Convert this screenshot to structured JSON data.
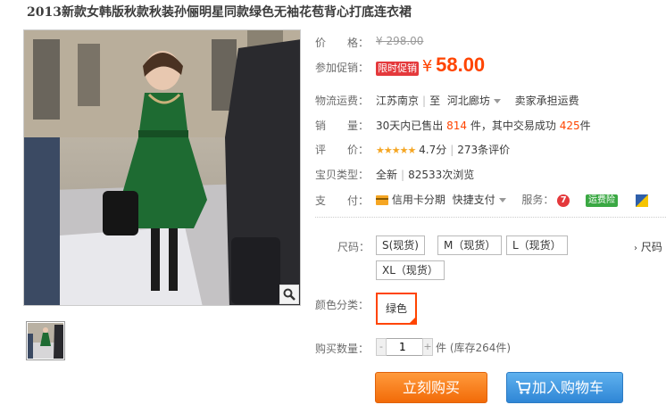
{
  "title": "2013新款女韩版秋款秋装孙俪明星同款绿色无袖花苞背心打底连衣裙",
  "price": {
    "label": "价　　格：",
    "original": "¥ 298.00"
  },
  "promo": {
    "label": "参加促销：",
    "tag": "限时促销",
    "yen": "¥",
    "value": "58.00"
  },
  "shipping": {
    "label": "物流运费：",
    "from": "江苏南京",
    "to": "至",
    "dest": "河北廊坊",
    "fee": "卖家承担运费"
  },
  "sales": {
    "label": "销　　量：",
    "prefix": "30天内已售出",
    "sold": "814",
    "mid": "件，其中交易成功",
    "success": "425",
    "suffix": "件"
  },
  "rating": {
    "label": "评　　价：",
    "stars": "★★★★★",
    "score": "4.7分",
    "reviews": "273条评价"
  },
  "type": {
    "label": "宝贝类型：",
    "value": "全新",
    "views": "82533次浏览"
  },
  "payment": {
    "label": "支　　付：",
    "credit": "信用卡分期",
    "quick": "快捷支付",
    "service_label": "服务：",
    "badge_7": "7",
    "insurance": "运费险"
  },
  "sizes": {
    "label": "尺码：",
    "options": [
      "S(现货)",
      "M（现货）",
      "L（现货）",
      "XL（现货）"
    ],
    "side_label": "尺码"
  },
  "color": {
    "label": "颜色分类：",
    "selected": "绿色"
  },
  "quantity": {
    "label": "购买数量：",
    "value": "1",
    "minus": "-",
    "plus": "+",
    "stock": "件 (库存264件)"
  },
  "buttons": {
    "buy": "立刻购买",
    "cart": "加入购物车"
  },
  "colors": {
    "accent": "#ff4400",
    "buy": "#f26b08",
    "cart": "#2f86d6",
    "dress": "#1e6b32"
  }
}
